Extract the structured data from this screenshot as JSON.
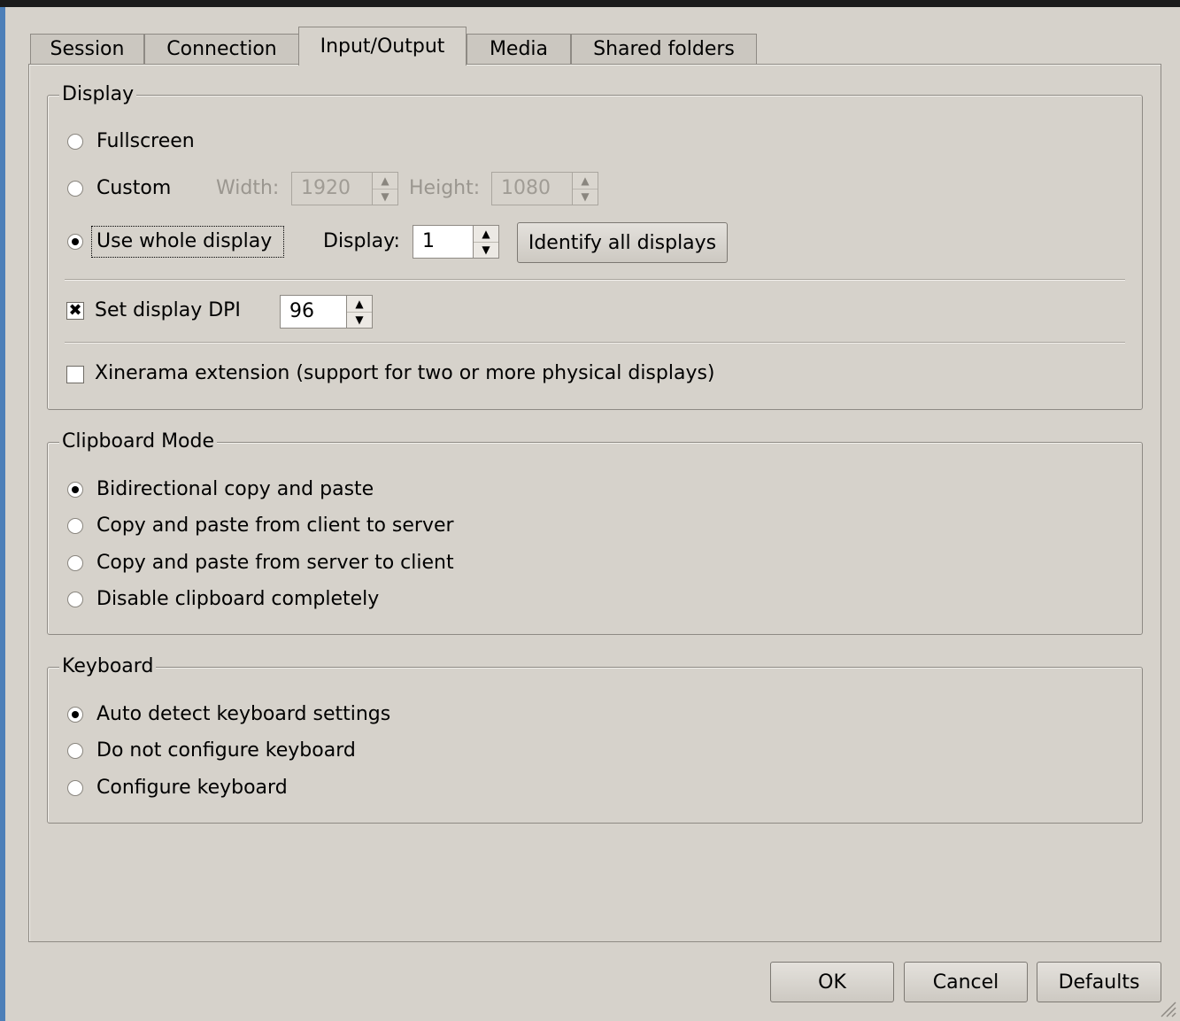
{
  "tabs": [
    {
      "label": "Session"
    },
    {
      "label": "Connection"
    },
    {
      "label": "Input/Output"
    },
    {
      "label": "Media"
    },
    {
      "label": "Shared folders"
    }
  ],
  "display_group": {
    "title": "Display",
    "fullscreen_label": "Fullscreen",
    "custom_label": "Custom",
    "width_label": "Width:",
    "width_value": "1920",
    "height_label": "Height:",
    "height_value": "1080",
    "whole_display_label": "Use whole display",
    "display_label": "Display:",
    "display_value": "1",
    "identify_button": "Identify all displays",
    "dpi_label": "Set display DPI",
    "dpi_value": "96",
    "xinerama_label": "Xinerama extension (support for two or more physical displays)"
  },
  "clipboard_group": {
    "title": "Clipboard Mode",
    "options": [
      "Bidirectional copy and paste",
      "Copy and paste from client to server",
      "Copy and paste from server to client",
      "Disable clipboard completely"
    ]
  },
  "keyboard_group": {
    "title": "Keyboard",
    "options": [
      "Auto detect keyboard settings",
      "Do not configure keyboard",
      "Configure keyboard"
    ]
  },
  "buttons": {
    "ok": "OK",
    "cancel": "Cancel",
    "defaults": "Defaults"
  },
  "state": {
    "active_tab": "Input/Output",
    "display_mode": "Use whole display",
    "dpi_checked": true,
    "xinerama_checked": false,
    "clipboard_selected": "Bidirectional copy and paste",
    "keyboard_selected": "Auto detect keyboard settings"
  }
}
